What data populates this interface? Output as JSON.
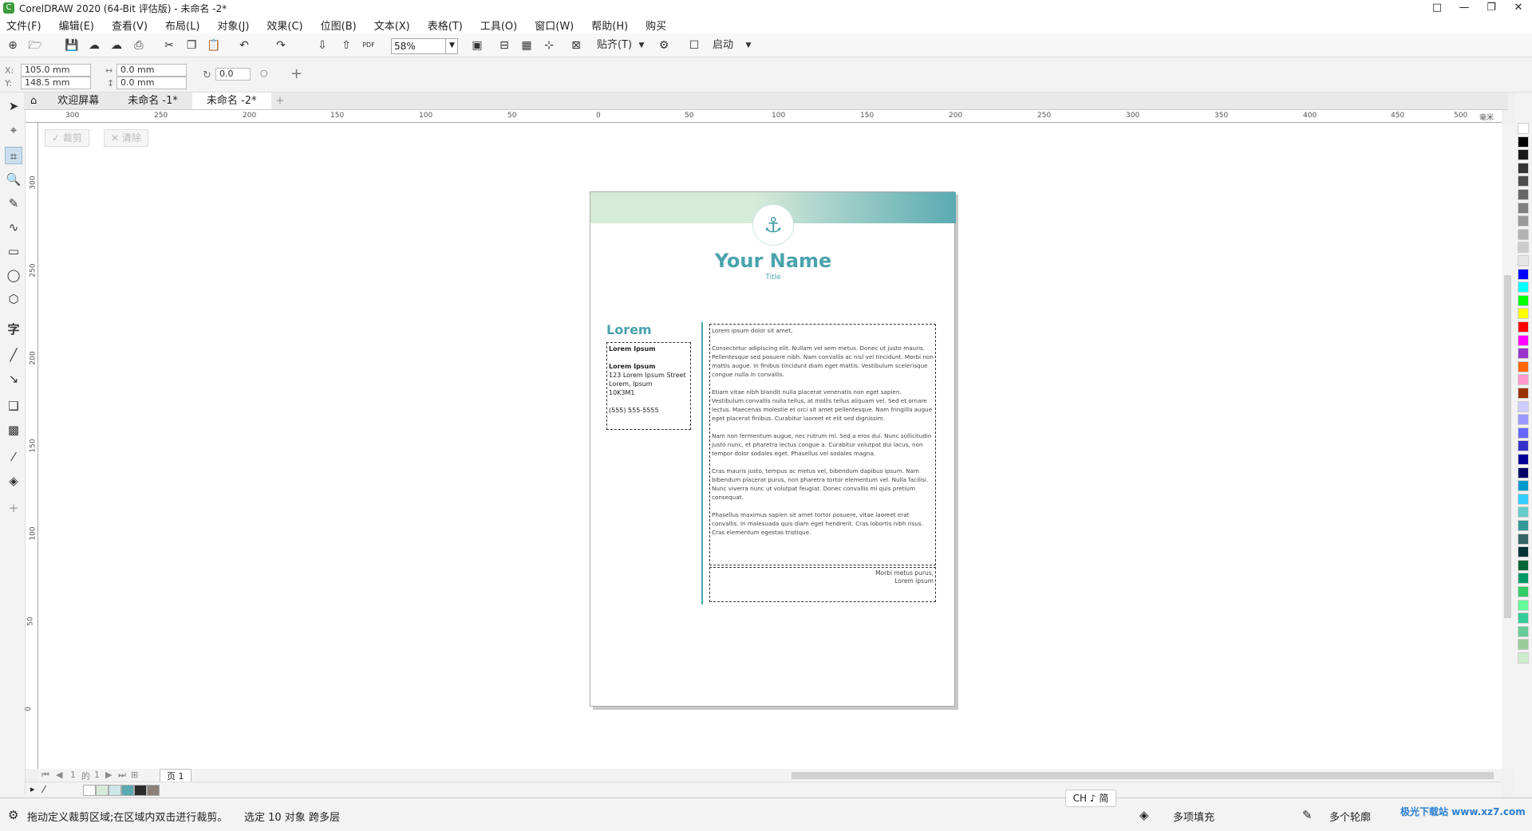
{
  "window": {
    "title": "CorelDRAW 2020 (64-Bit 评估版) - 未命名 -2*",
    "logo_letter": "C",
    "buttons": {
      "restore_icon": "□",
      "minimize": "—",
      "maximize": "❐",
      "close": "✕"
    }
  },
  "menu": [
    "文件(F)",
    "编辑(E)",
    "查看(V)",
    "布局(L)",
    "对象(J)",
    "效果(C)",
    "位图(B)",
    "文本(X)",
    "表格(T)",
    "工具(O)",
    "窗口(W)",
    "帮助(H)",
    "购买"
  ],
  "toolbar": {
    "zoom_value": "58%",
    "snap_label": "贴齐(T)",
    "launch_label": "启动",
    "pdf_label": "PDF"
  },
  "propbar": {
    "x_label": "X:",
    "x_value": "105.0 mm",
    "y_label": "Y:",
    "y_value": "148.5 mm",
    "w_value": "0.0 mm",
    "h_value": "0.0 mm",
    "angle_value": "0.0"
  },
  "tabs": [
    {
      "label": "欢迎屏幕",
      "active": false
    },
    {
      "label": "未命名 -1*",
      "active": false
    },
    {
      "label": "未命名 -2*",
      "active": true
    }
  ],
  "crop_controls": {
    "crop_label": "裁剪",
    "clear_label": "清除"
  },
  "ruler": {
    "h_ticks": [
      "300",
      "250",
      "200",
      "150",
      "100",
      "50",
      "0",
      "50",
      "100",
      "150",
      "200",
      "250",
      "300",
      "350",
      "400",
      "450",
      "500"
    ],
    "h_unit": "毫米",
    "v_ticks": [
      "300",
      "250",
      "200",
      "150",
      "100",
      "50",
      "0"
    ]
  },
  "document": {
    "name": "Your Name",
    "title": "Title",
    "side_heading": "Lorem",
    "side_lines": [
      "Lorem Ipsum",
      "",
      "Lorem Ipsum",
      "123 Lorem Ipsum Street",
      "Lorem, Ipsum",
      "10K3M1",
      "",
      "(555) 555-5555"
    ],
    "main_paragraphs": [
      "Lorem ipsum dolor sit amet,",
      "Consectetur adipiscing elit. Nullam vel sem metus. Donec ut justo mauris. Pellentesque sed posuere nibh. Nam convallis ac nisl vel tincidunt. Morbi non mattis augue. In finibus tincidunt diam eget mattis. Vestibulum scelerisque congue nulla in convallis.",
      "Etiam vitae nibh blandit nulla placerat venenatis non eget sapien. Vestibulum convallis nulla tellus, at mollis tellus aliquam vel. Sed et ornare lectus. Maecenas molestie et orci sit amet pellentesque. Nam fringilla augue eget placerat finibus. Curabitur laoreet et elit sed dignissim.",
      "Nam non fermentum augue, nec rutrum mi. Sed a eros dui. Nunc sollicitudin justo nunc, et pharetra lectus congue a. Curabitur volutpat dui lacus, non tempor dolor sodales eget. Phasellus vel sodales magna.",
      "Cras mauris justo, tempus ac metus vel, bibendum dapibus ipsum. Nam bibendum placerat purus, non pharetra tortor elementum vel. Nulla facilisi. Nunc viverra nunc ut volutpat feugiat. Donec convallis mi quis pretium consequat.",
      "Phasellus maximus sapien sit amet tortor posuere, vitae laoreet erat convallis. In malesuada quis diam eget hendrerit. Cras lobortis nibh risus. Cras elementum egestas tristique."
    ],
    "footer_lines": [
      "Morbi metus purus,",
      "Lorem ipsum"
    ]
  },
  "pagenav": {
    "current": "1",
    "of": "的",
    "total": "1",
    "page_tab": "页 1"
  },
  "status": {
    "hint": "拖动定义裁剪区域;在区域内双击进行裁剪。",
    "selection": "选定 10 对象 跨多层",
    "fill_label": "多项填充",
    "outline_label": "多个轮廓",
    "ime": "CH ♪ 简"
  },
  "watermark": "极光下载站 www.xz7.com",
  "colors": {
    "accent": "#4aa3ac",
    "header_light": "#d6ebd9",
    "header_dark": "#5aaab2",
    "palette": [
      "#ffffff",
      "#000000",
      "#1a1a1a",
      "#333333",
      "#4d4d4d",
      "#666666",
      "#808080",
      "#999999",
      "#b3b3b3",
      "#cccccc",
      "#e6e6e6",
      "#0000ff",
      "#00ffff",
      "#00ff00",
      "#ffff00",
      "#ff0000",
      "#ff00ff",
      "#9933cc",
      "#ff6600",
      "#ff99cc",
      "#993300",
      "#ccccff",
      "#9999ff",
      "#6666ff",
      "#3333cc",
      "#000099",
      "#000066",
      "#0099cc",
      "#33ccff",
      "#66cccc",
      "#339999",
      "#336666",
      "#003333",
      "#006633",
      "#009966",
      "#33cc66",
      "#66ff99",
      "#33cc99",
      "#66cc99",
      "#99cc99",
      "#cceecc"
    ],
    "doc_palette": [
      "#ffffff",
      "#d6ebd9",
      "#cde6e8",
      "#5aaab2",
      "#2b2b2b",
      "#8a8078"
    ]
  }
}
